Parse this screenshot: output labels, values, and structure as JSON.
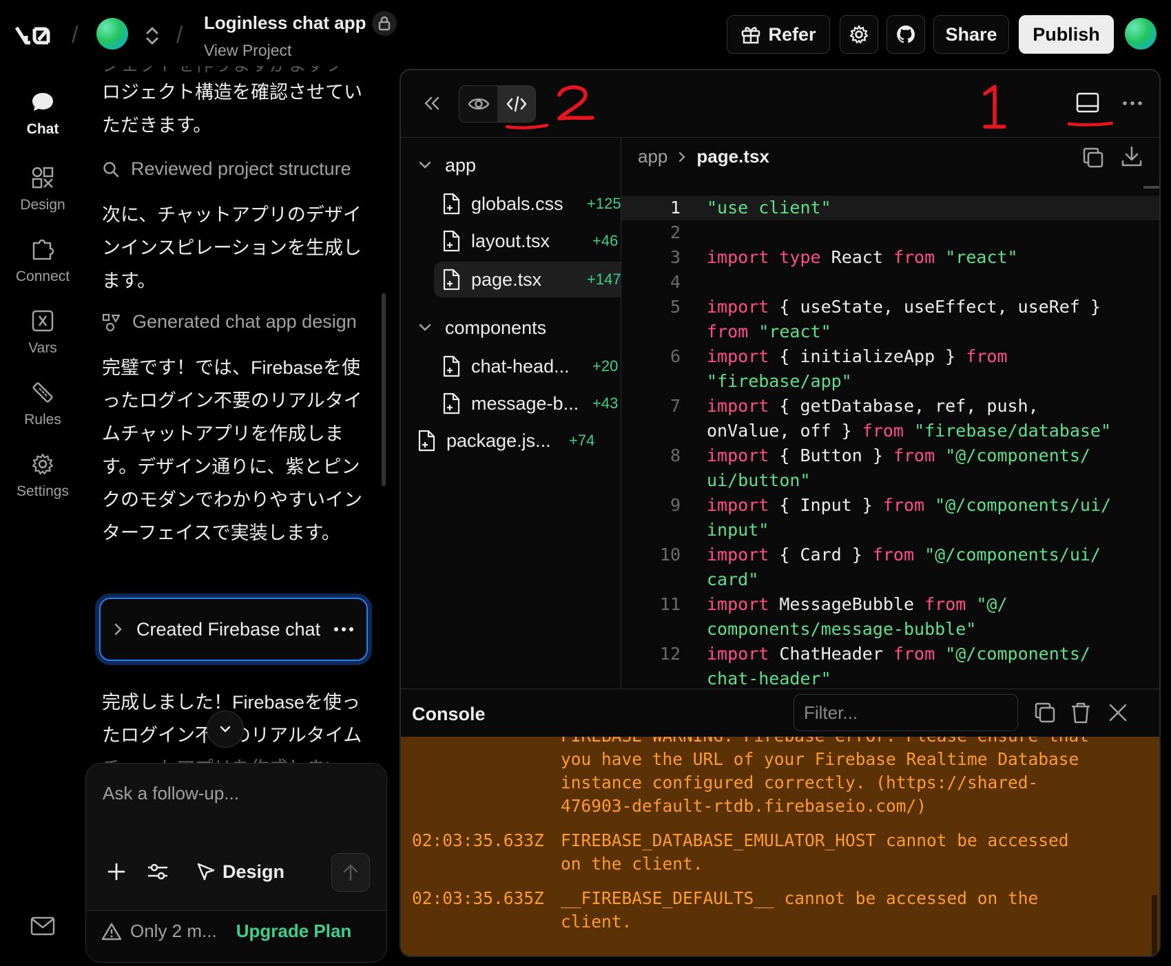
{
  "topbar": {
    "logo_text": "v0",
    "project_title": "Loginless chat app",
    "project_sub": "View Project",
    "refer_label": "Refer",
    "share_label": "Share",
    "publish_label": "Publish"
  },
  "nav": {
    "chat": "Chat",
    "design": "Design",
    "connect": "Connect",
    "vars": "Vars",
    "rules": "Rules",
    "settings": "Settings"
  },
  "chat": {
    "msg0_faded": "ジェクトを作りますがまずプ",
    "msg0": "ロジェクト構造を確認させていただきます。",
    "step1": "Reviewed project structure",
    "msg1": "次に、チャットアプリのデザインインスピレーションを生成します。",
    "step2": "Generated chat app design",
    "msg2": "完璧です！では、Firebaseを使ったログイン不要のリアルタイムチャットアプリを作成します。デザイン通りに、紫とピンクのモダンでわかりやすいインターフェイスで実装します。",
    "created_card": "Created Firebase chat app",
    "msg3": "完成しました！Firebaseを使ったログイン不要のリアルタイムチャットアプリを作成しま!",
    "composer_placeholder": "Ask a follow-up...",
    "design_label": "Design",
    "limit_text": "Only 2 m...",
    "upgrade_label": "Upgrade Plan"
  },
  "annotations": {
    "one": "1",
    "two": "2"
  },
  "tree": {
    "folder_app": "app",
    "files_app": [
      {
        "name": "globals.css",
        "diff": "+125"
      },
      {
        "name": "layout.tsx",
        "diff": "+46"
      },
      {
        "name": "page.tsx",
        "diff": "+147"
      }
    ],
    "folder_components": "components",
    "files_components": [
      {
        "name": "chat-head...",
        "diff": "+20"
      },
      {
        "name": "message-b...",
        "diff": "+43"
      }
    ],
    "root_file": {
      "name": "package.js...",
      "diff": "+74"
    }
  },
  "editor": {
    "crumb_folder": "app",
    "crumb_file": "page.tsx",
    "line_numbers": [
      "1",
      "2",
      "3",
      "4",
      "5",
      "6",
      "7",
      "8",
      "9",
      "10",
      "11",
      "12"
    ]
  },
  "console": {
    "title": "Console",
    "filter_placeholder": "Filter...",
    "log0": "FIREBASE WARNING: Firebase error. Please ensure that you have the URL of your Firebase Realtime Database instance configured correctly. (https://shared-476903-default-rtdb.firebaseio.com/)",
    "log1_time": "02:03:35.633Z",
    "log1_msg": "FIREBASE_DATABASE_EMULATOR_HOST cannot be accessed on the client.",
    "log2_time": "02:03:35.635Z",
    "log2_msg": "__FIREBASE_DEFAULTS__ cannot be accessed on the client."
  },
  "colors": {
    "accent_green": "#3ecf8e",
    "keyword": "#ff4d8d",
    "string": "#5ee08a",
    "console_bg": "#5b3205",
    "console_text": "#ff9a2e",
    "annotation_red": "#e8141e"
  }
}
